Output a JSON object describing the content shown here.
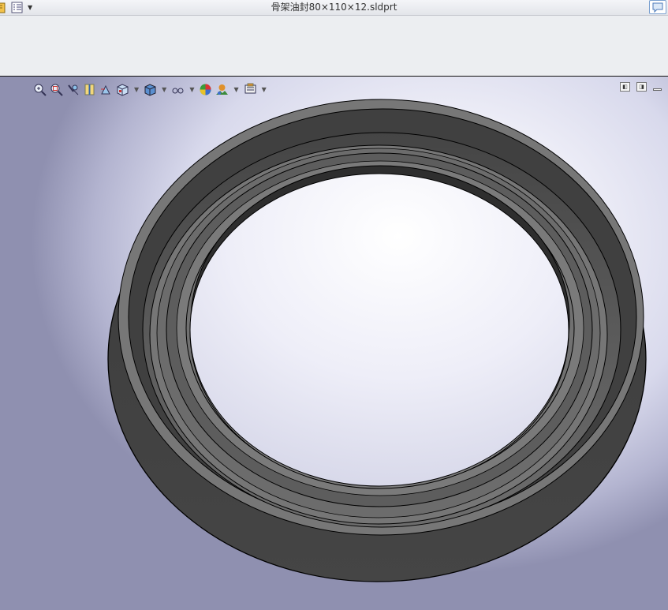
{
  "window": {
    "title": "骨架油封80×110×12.sldprt"
  },
  "titlebar": {
    "left_icons": [
      "part-doc-icon",
      "options-list-icon",
      "dropdown-arrow"
    ],
    "right_icon": "comment-bubble-icon"
  },
  "heads_up_toolbar": {
    "icons": [
      "zoom-to-fit-icon",
      "zoom-to-area-icon",
      "previous-view-icon",
      "section-view-icon",
      "dynamic-annotation-icon",
      "view-orientation-icon",
      "display-style-icon",
      "hide-show-items-icon",
      "edit-appearance-icon",
      "apply-scene-icon",
      "view-settings-icon"
    ]
  },
  "viewport_controls": [
    "split-view-left-icon",
    "split-view-right-icon",
    "minimize-icon"
  ],
  "colors": {
    "ring_dark": "#3f3f3f",
    "ring_mid": "#6e6e6e",
    "ring_light": "#8a8a8a",
    "edge": "#000000",
    "bg_center": "#ffffff",
    "bg_edge": "#8f90b0"
  }
}
